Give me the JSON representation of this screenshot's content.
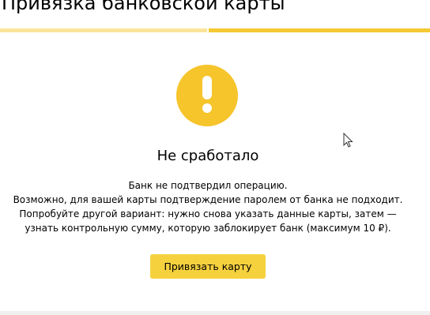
{
  "header": {
    "title": "Привязка банковской карты"
  },
  "progress": {
    "steps_total": 2,
    "current_step": 2,
    "colors": {
      "done": "#fbe39a",
      "current": "#f5c933"
    }
  },
  "status": {
    "icon": "exclamation-icon",
    "icon_color": "#f6c42b",
    "heading": "Не сработало",
    "message_lines": [
      "Банк не подтвердил операцию.",
      "Возможно, для вашей карты подтверждение паролем от банка не подходит.",
      "Попробуйте другой вариант: нужно снова указать данные карты, затем —",
      "узнать контрольную сумму, которую заблокирует банк (максимум 10 ₽)."
    ]
  },
  "actions": {
    "bind_card_label": "Привязать карту",
    "button_color": "#f6d13e"
  }
}
